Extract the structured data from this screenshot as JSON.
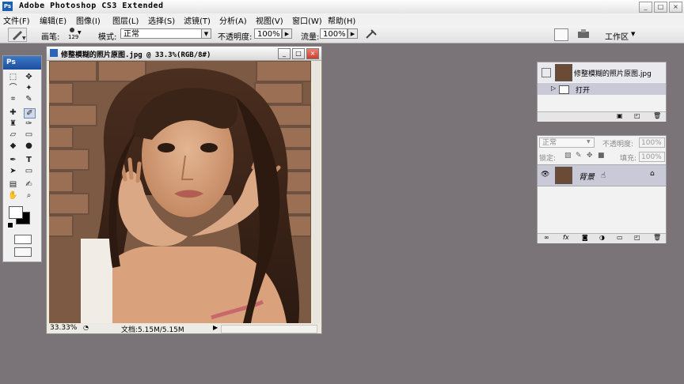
{
  "app": {
    "title": "Adobe Photoshop CS3 Extended",
    "logo": "Ps"
  },
  "window_controls": {
    "minimize": "_",
    "maximize": "□",
    "close": "×"
  },
  "menu": [
    "文件(F)",
    "编辑(E)",
    "图像(I)",
    "图层(L)",
    "选择(S)",
    "滤镜(T)",
    "分析(A)",
    "视图(V)",
    "窗口(W)",
    "帮助(H)"
  ],
  "options": {
    "brush_label": "画笔:",
    "brush_size": "129",
    "mode_label": "模式:",
    "mode_value": "正常",
    "opacity_label": "不透明度:",
    "opacity_value": "100%",
    "flow_label": "流量:",
    "flow_value": "100%",
    "workspace_label": "工作区"
  },
  "toolbox": {
    "header": "Ps"
  },
  "document": {
    "title": "修整模糊的照片原图.jpg @ 33.3%(RGB/8#)",
    "zoom": "33.33%",
    "doc_info": "文档:5.15M/5.15M"
  },
  "history_panel": {
    "snapshot_name": "修整模糊的照片原图.jpg",
    "state_open": "打开"
  },
  "layers_panel": {
    "blend_mode": "正常",
    "opacity_label": "不透明度:",
    "opacity_value": "100%",
    "lock_label": "锁定:",
    "fill_label": "填充:",
    "fill_value": "100%",
    "layer_name": "背景"
  },
  "colors": {
    "workspace_bg": "#7a7479",
    "panel_bg": "#f2f2f2",
    "titlebar_blue": "#1d4f9e",
    "selected_row": "#c9c9d8"
  }
}
